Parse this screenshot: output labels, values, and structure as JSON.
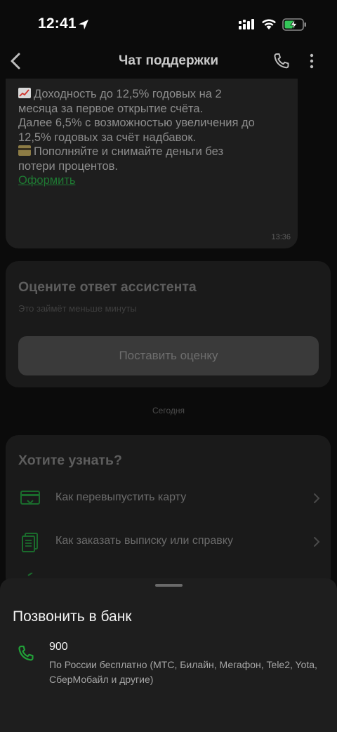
{
  "status_bar": {
    "time": "12:41",
    "icons": [
      "location-arrow-icon",
      "cellular-signal-icon",
      "wifi-icon",
      "battery-charging-icon"
    ]
  },
  "header": {
    "title": "Чат поддержки",
    "back_icon": "chevron-left-icon",
    "call_icon": "phone-icon",
    "menu_icon": "more-vertical-icon"
  },
  "message": {
    "lines": [
      "Доходность до 12,5% годовых на 2",
      "месяца за первое открытие счёта.",
      "Далее 6,5% с возможностью увеличения до",
      "12,5% годовых за счёт надбавок.",
      "Пополняйте и снимайте деньги без",
      "потери процентов."
    ],
    "link": "Оформить",
    "time": "13:36",
    "emoji_icons": [
      "chart-increasing-icon",
      "credit-card-icon"
    ]
  },
  "rate_card": {
    "title": "Оцените ответ ассистента",
    "subtitle": "Это займёт меньше минуты",
    "button": "Поставить оценку"
  },
  "date_separator": "Сегодня",
  "know_card": {
    "title": "Хотите узнать?",
    "items": [
      {
        "label": "Как перевыпустить карту",
        "icon": "card-reissue-icon"
      },
      {
        "label": "Как заказать выписку или справку",
        "icon": "document-icon"
      }
    ]
  },
  "sheet": {
    "title": "Позвонить в банк",
    "number": "900",
    "description": "По России бесплатно (МТС, Билайн, Мегафон, Tele2, Yota, СберМобайл и другие)"
  },
  "colors": {
    "accent_green": "#21a038",
    "link_green": "#1f7a33",
    "background": "#0b0b0b",
    "sheet": "#1e1e1e"
  }
}
